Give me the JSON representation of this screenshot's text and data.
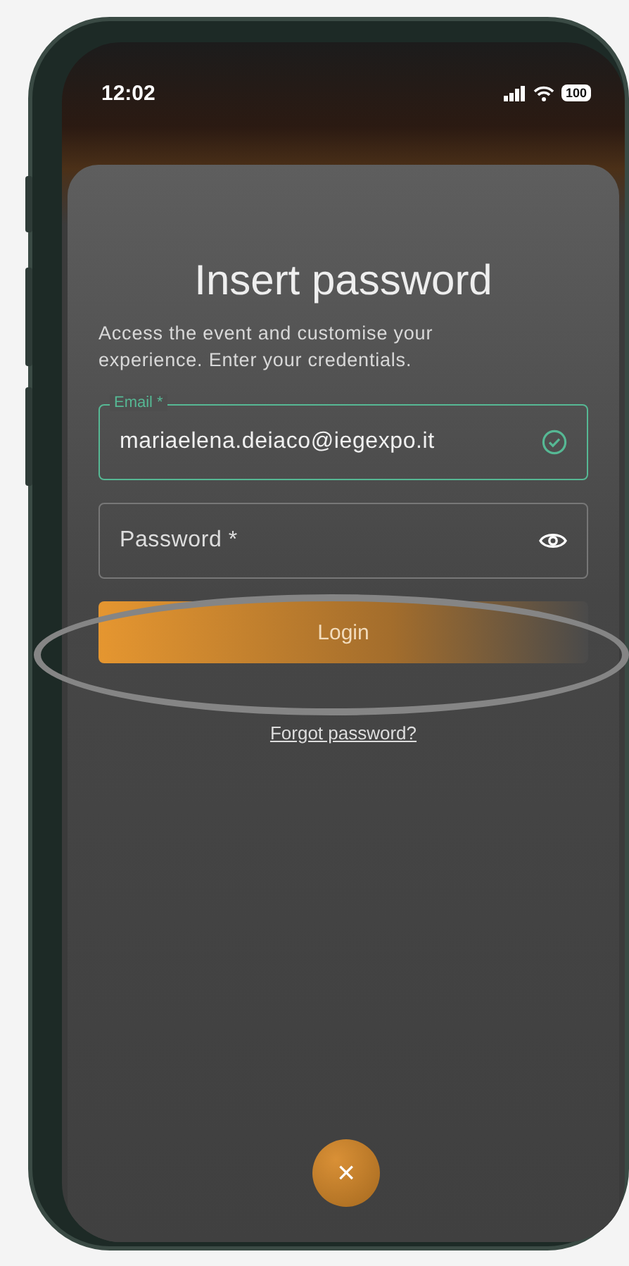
{
  "status_bar": {
    "time": "12:02",
    "battery": "100"
  },
  "card": {
    "title": "Insert password",
    "description": "Access the event and customise your experience. Enter your credentials."
  },
  "fields": [
    {
      "kind": "email",
      "label": "Email *",
      "value": "mariaelena.deiaco@iegexpo.it",
      "valid": true
    },
    {
      "kind": "password",
      "placeholder": "Password *"
    }
  ],
  "login_button": {
    "label": "Login"
  },
  "forgot_link": {
    "label": "Forgot password?"
  },
  "close_button": {
    "label": "×"
  }
}
